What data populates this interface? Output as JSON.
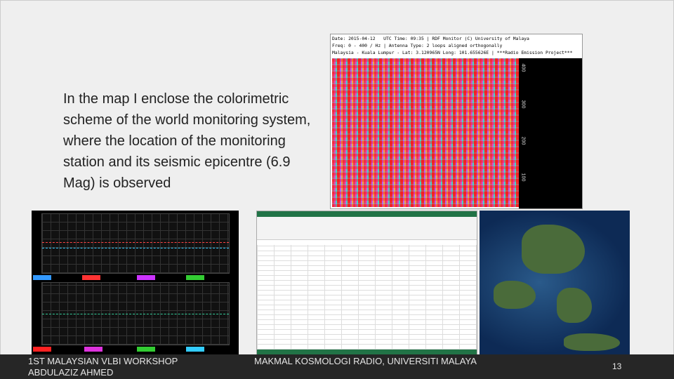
{
  "slide": {
    "body_text": "In the map I enclose the colorimetric scheme of the world monitoring system, where the location of the monitoring station and its seismic epicentre (6.9 Mag) is observed",
    "spectrogram_header": [
      "Date: 2015-04-12   UTC Time: 09:35 | RDF Monitor (C) University of Malaya",
      "Freq: 0 - 400 / Hz | Antenna Type: 2 loops aligned orthogonally",
      "Malaysia - Kuala Lumpur - Lat: 3.120965N Long: 101.655626E | ***Radio Emission Project***"
    ],
    "spectrogram_axis": [
      "400",
      "300",
      "200",
      "100"
    ]
  },
  "footer": {
    "workshop": "1ST MALAYSIAN VLBI WORKSHOP",
    "author": "ABDULAZIZ AHMED",
    "lab": "MAKMAL KOSMOLOGI RADIO, UNIVERSITI MALAYA",
    "page_number": "13"
  }
}
